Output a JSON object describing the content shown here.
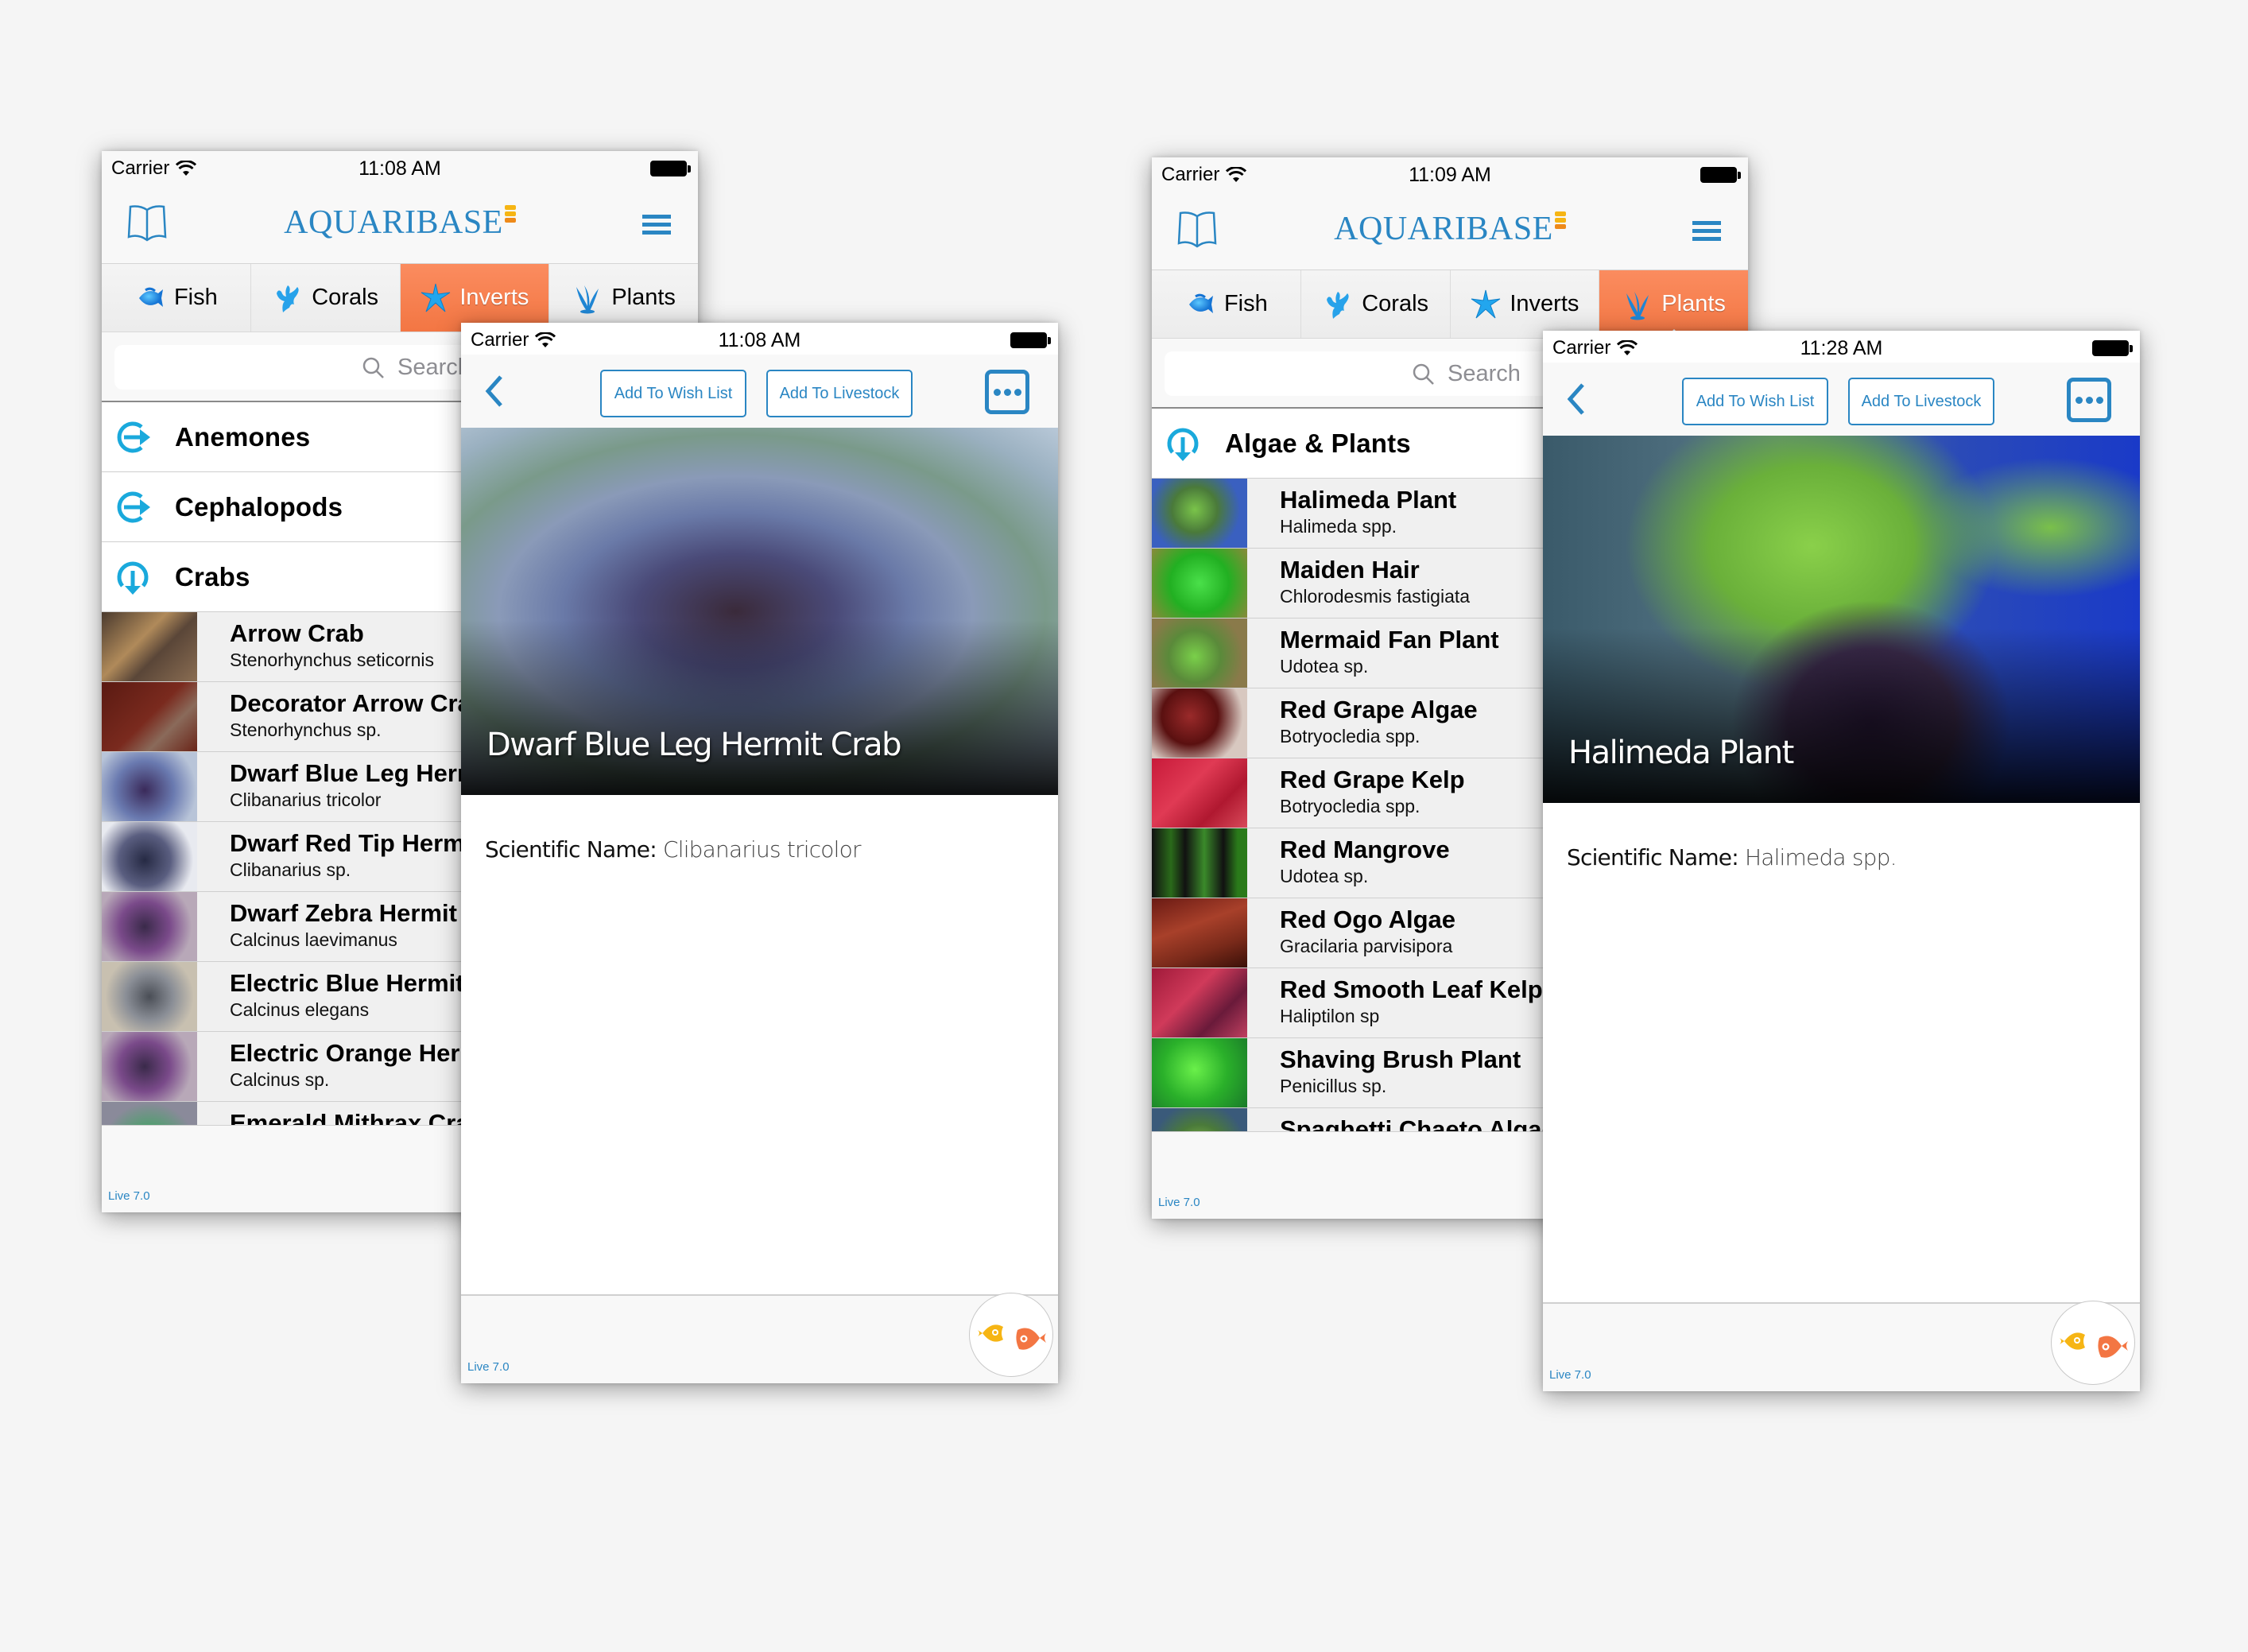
{
  "screens": {
    "left_list": {
      "status": {
        "carrier": "Carrier",
        "time": "11:08 AM"
      },
      "logo": "AQUARIBASE",
      "tabs": [
        {
          "label": "Fish",
          "icon": "fish-icon",
          "active": false
        },
        {
          "label": "Corals",
          "icon": "coral-icon",
          "active": false
        },
        {
          "label": "Inverts",
          "icon": "starfish-icon",
          "active": true
        },
        {
          "label": "Plants",
          "icon": "seaweed-icon",
          "active": false
        }
      ],
      "search_placeholder": "Search",
      "categories": [
        {
          "label": "Anemones",
          "icon": "collapsed-arrow-icon",
          "expanded": false
        },
        {
          "label": "Cephalopods",
          "icon": "collapsed-arrow-icon",
          "expanded": false
        },
        {
          "label": "Crabs",
          "icon": "expanded-arrow-icon",
          "expanded": true
        }
      ],
      "items": [
        {
          "name": "Arrow Crab",
          "scientific": "Stenorhynchus seticornis"
        },
        {
          "name": "Decorator Arrow Crab",
          "scientific": "Stenorhynchus sp."
        },
        {
          "name": "Dwarf Blue Leg Hermit Crab",
          "scientific": "Clibanarius tricolor"
        },
        {
          "name": "Dwarf Red Tip Hermit Crab",
          "scientific": "Clibanarius sp."
        },
        {
          "name": "Dwarf Zebra Hermit Crab",
          "scientific": "Calcinus laevimanus"
        },
        {
          "name": "Electric Blue Hermit Crab",
          "scientific": "Calcinus elegans"
        },
        {
          "name": "Electric Orange Hermit Crab",
          "scientific": "Calcinus sp."
        },
        {
          "name": "Emerald Mithrax Crab",
          "scientific": ""
        }
      ],
      "version": "Live 7.0"
    },
    "left_detail": {
      "status": {
        "carrier": "Carrier",
        "time": "11:08 AM"
      },
      "wishlist_label": "Add To Wish List",
      "livestock_label": "Add To Livestock",
      "title": "Dwarf Blue Leg Hermit Crab",
      "scientific_label": "Scientific Name:",
      "scientific_value": "Clibanarius tricolor",
      "version": "Live 7.0"
    },
    "right_list": {
      "status": {
        "carrier": "Carrier",
        "time": "11:09 AM"
      },
      "logo": "AQUARIBASE",
      "tabs": [
        {
          "label": "Fish",
          "icon": "fish-icon",
          "active": false
        },
        {
          "label": "Corals",
          "icon": "coral-icon",
          "active": false
        },
        {
          "label": "Inverts",
          "icon": "starfish-icon",
          "active": false
        },
        {
          "label": "Plants",
          "icon": "seaweed-icon",
          "active": true
        }
      ],
      "search_placeholder": "Search",
      "categories": [
        {
          "label": "Algae & Plants",
          "icon": "expanded-arrow-icon",
          "expanded": true
        }
      ],
      "items": [
        {
          "name": "Halimeda Plant",
          "scientific": "Halimeda spp."
        },
        {
          "name": "Maiden Hair",
          "scientific": "Chlorodesmis fastigiata"
        },
        {
          "name": "Mermaid Fan Plant",
          "scientific": "Udotea sp."
        },
        {
          "name": "Red Grape Algae",
          "scientific": "Botryocledia spp."
        },
        {
          "name": "Red Grape Kelp",
          "scientific": "Botryocledia spp."
        },
        {
          "name": "Red Mangrove",
          "scientific": "Udotea sp."
        },
        {
          "name": "Red Ogo Algae",
          "scientific": "Gracilaria parvisipora"
        },
        {
          "name": "Red Smooth Leaf Kelp",
          "scientific": "Haliptilon sp"
        },
        {
          "name": "Shaving Brush Plant",
          "scientific": "Penicillus sp."
        },
        {
          "name": "Spaghetti Chaeto Algae",
          "scientific": ""
        }
      ],
      "version": "Live 7.0"
    },
    "right_detail": {
      "status": {
        "carrier": "Carrier",
        "time": "11:28 AM"
      },
      "wishlist_label": "Add To Wish List",
      "livestock_label": "Add To Livestock",
      "title": "Halimeda Plant",
      "scientific_label": "Scientific Name:",
      "scientific_value": "Halimeda spp.",
      "version": "Live 7.0"
    }
  },
  "colors": {
    "brand_blue": "#2a86c3",
    "accent_orange": "#f37643",
    "icon_cyan": "#1aa9dc",
    "logo_yellow": "#f6b514",
    "logo_orange": "#ee8a1a"
  }
}
